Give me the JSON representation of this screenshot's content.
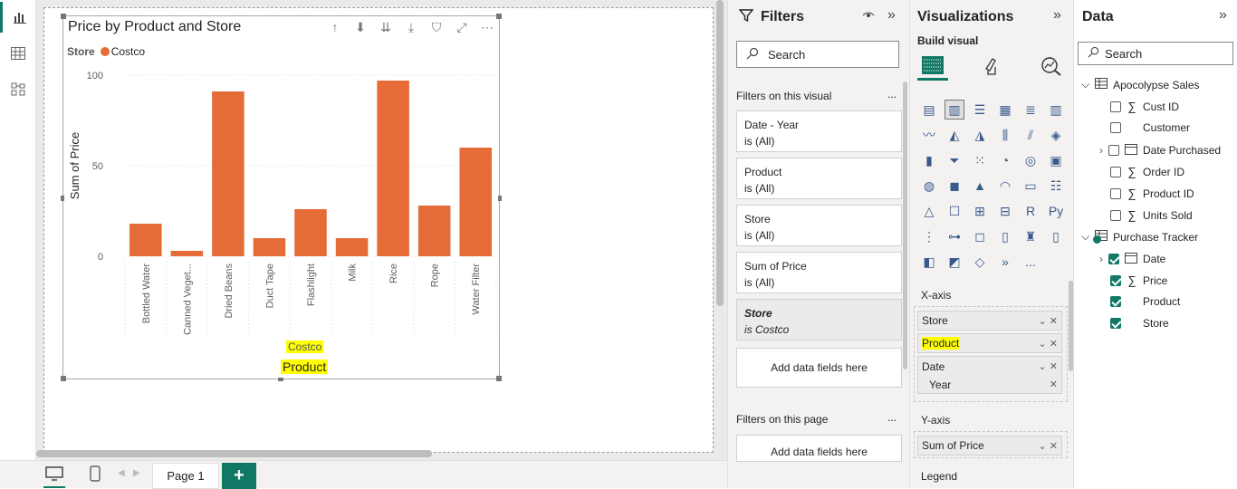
{
  "rail": {
    "icons": [
      "report-view-icon",
      "table-view-icon",
      "model-view-icon"
    ]
  },
  "visual": {
    "title": "Price by Product and Store",
    "legend_title": "Store",
    "legend_item": "Costco",
    "x_sel_store": "Costco",
    "x_sel_product": "Product"
  },
  "chart_data": {
    "type": "bar",
    "title": "Price by Product and Store",
    "ylabel": "Sum of Price",
    "xlabel": "Product",
    "ylim": [
      0,
      100
    ],
    "yticks": [
      "0",
      "50",
      "100"
    ],
    "categories": [
      "Bottled Water",
      "Canned Veget...",
      "Dried Beans",
      "Duct Tape",
      "Flashlight",
      "Milk",
      "Rice",
      "Rope",
      "Water Filter"
    ],
    "series": [
      {
        "name": "Costco",
        "values": [
          18,
          3,
          91,
          10,
          26,
          10,
          97,
          28,
          60
        ],
        "color": "#e66c37"
      }
    ]
  },
  "bottom": {
    "page_tab": "Page 1",
    "add_page": "+"
  },
  "filters": {
    "title": "Filters",
    "search_placeholder": "Search",
    "on_visual_label": "Filters on this visual",
    "more": "...",
    "cards": [
      {
        "name": "Date - Year",
        "state": "is (All)"
      },
      {
        "name": "Product",
        "state": "is (All)"
      },
      {
        "name": "Store",
        "state": "is (All)"
      },
      {
        "name": "Sum of Price",
        "state": "is (All)"
      },
      {
        "name": "Store",
        "state": "is Costco"
      }
    ],
    "add_fields": "Add data fields here",
    "on_page_label": "Filters on this page",
    "add_fields_page": "Add data fields here"
  },
  "viz": {
    "title": "Visualizations",
    "build_visual": "Build visual",
    "x_axis_label": "X-axis",
    "x_wells": [
      "Store",
      "Product",
      "Date"
    ],
    "x_sub": "Year",
    "y_axis_label": "Y-axis",
    "y_well": "Sum of Price",
    "legend_label": "Legend",
    "icon_more": "..."
  },
  "data": {
    "title": "Data",
    "search_placeholder": "Search",
    "tables": [
      {
        "name": "Apocolypse Sales",
        "fields": [
          "Cust ID",
          "Customer",
          "Date Purchased",
          "Order ID",
          "Product ID",
          "Units Sold"
        ]
      },
      {
        "name": "Purchase Tracker",
        "fields": [
          "Date",
          "Price",
          "Product",
          "Store"
        ]
      }
    ]
  }
}
